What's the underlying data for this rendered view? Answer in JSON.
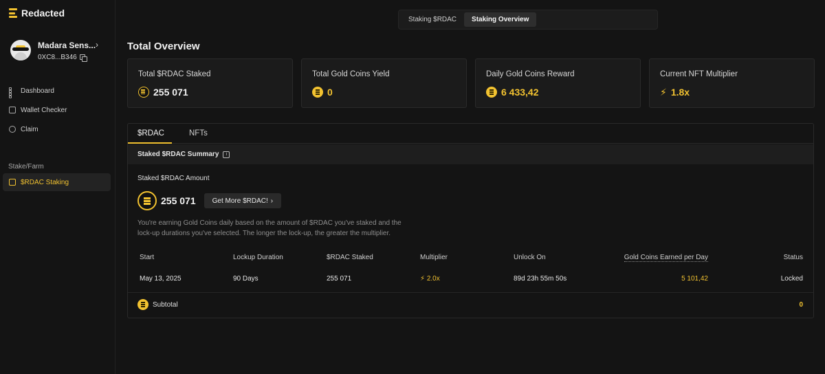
{
  "app": {
    "name": "Redacted"
  },
  "profile": {
    "name": "Madara Sens...",
    "address": "0XC8...B346"
  },
  "nav": {
    "items": [
      {
        "label": "Dashboard"
      },
      {
        "label": "Wallet Checker"
      },
      {
        "label": "Claim"
      }
    ],
    "section_label": "Stake/Farm",
    "staking": {
      "label": "$RDAC Staking"
    }
  },
  "top_tabs": [
    "Staking $RDAC",
    "Staking Overview"
  ],
  "page_title": "Total Overview",
  "stats": [
    {
      "label": "Total $RDAC Staked",
      "value": "255 071"
    },
    {
      "label": "Total Gold Coins Yield",
      "value": "0"
    },
    {
      "label": "Daily Gold Coins Reward",
      "value": "6 433,42"
    },
    {
      "label": "Current NFT Multiplier",
      "value": "1.8x"
    }
  ],
  "panel": {
    "tabs": [
      "$RDAC",
      "NFTs"
    ],
    "summary_title": "Staked $RDAC Summary",
    "amount_label": "Staked $RDAC Amount",
    "amount_value": "255 071",
    "get_more": "Get More $RDAC!",
    "description": "You're earning Gold Coins daily based on the amount of $RDAC you've staked and the lock-up durations you've selected. The longer the lock-up, the greater the multiplier.",
    "columns": [
      "Start",
      "Lockup Duration",
      "$RDAC Staked",
      "Multiplier",
      "Unlock On",
      "Gold Coins Earned per Day",
      "Status"
    ],
    "row": {
      "start": "May 13, 2025",
      "lockup": "90 Days",
      "staked": "255 071",
      "multiplier": "2.0x",
      "unlock": "89d 23h 55m 50s",
      "earned": "5 101,42",
      "status": "Locked"
    },
    "subtotal_label": "Subtotal",
    "subtotal_value": "0"
  },
  "colors": {
    "accent": "#f2c230",
    "background": "#141414",
    "card": "#1b1b1b"
  }
}
